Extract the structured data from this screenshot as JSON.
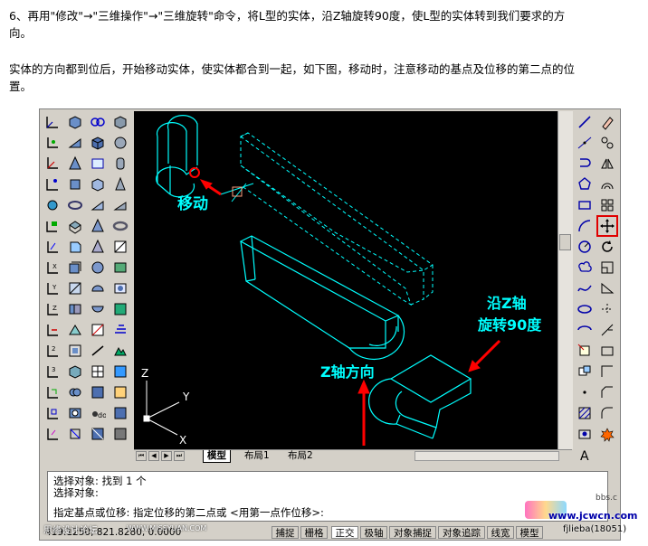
{
  "paragraphs": {
    "p1_line1": "6、再用\"修改\"→\"三维操作\"→\"三维旋转\"命令，将L型的实体，沿Z轴旋转90度，使L型的实体转到我们要求的方",
    "p1_line2": "向。",
    "p2_line1": "实体的方向都到位后，开始移动实体，使实体都合到一起，如下图，移动时，注意移动的基点及位移的第二点的位",
    "p2_line2": "置。"
  },
  "annotations": {
    "move_label": "移动",
    "rotate_line1": "沿Z轴",
    "rotate_line2": "旋转90度",
    "zaxis_label": "Z轴方向"
  },
  "ucs": {
    "z": "Z",
    "y": "Y",
    "x": "X"
  },
  "tabs": {
    "model": "模型",
    "layout1": "布局1",
    "layout2": "布局2"
  },
  "command": {
    "line1": "选择对象:  找到 1 个",
    "line2": "选择对象:",
    "line3": "指定基点或位移: 指定位移的第二点或 <用第一点作位移>:"
  },
  "status": {
    "coords": "419.1250, 821.8280, 0.0000",
    "snap": "捕捉",
    "grid": "栅格",
    "ortho": "正交",
    "polar": "极轴",
    "osnap": "对象捕捉",
    "otrack": "对象追踪",
    "lwt": "线宽",
    "model": "模型"
  },
  "watermark": {
    "site": "www.jcwcn.com",
    "bottom": "fjlieba(18051)",
    "corner": "bbs.c"
  },
  "forum_tag": "思缘设计论坛",
  "forum_url": "WWW.MISSYUAN.COM",
  "colors": {
    "cyan": "#00ffff",
    "red": "#ff0000",
    "viewport_bg": "#000000",
    "toolbar_bg": "#d4d0c8",
    "highlight": "#e00000"
  }
}
